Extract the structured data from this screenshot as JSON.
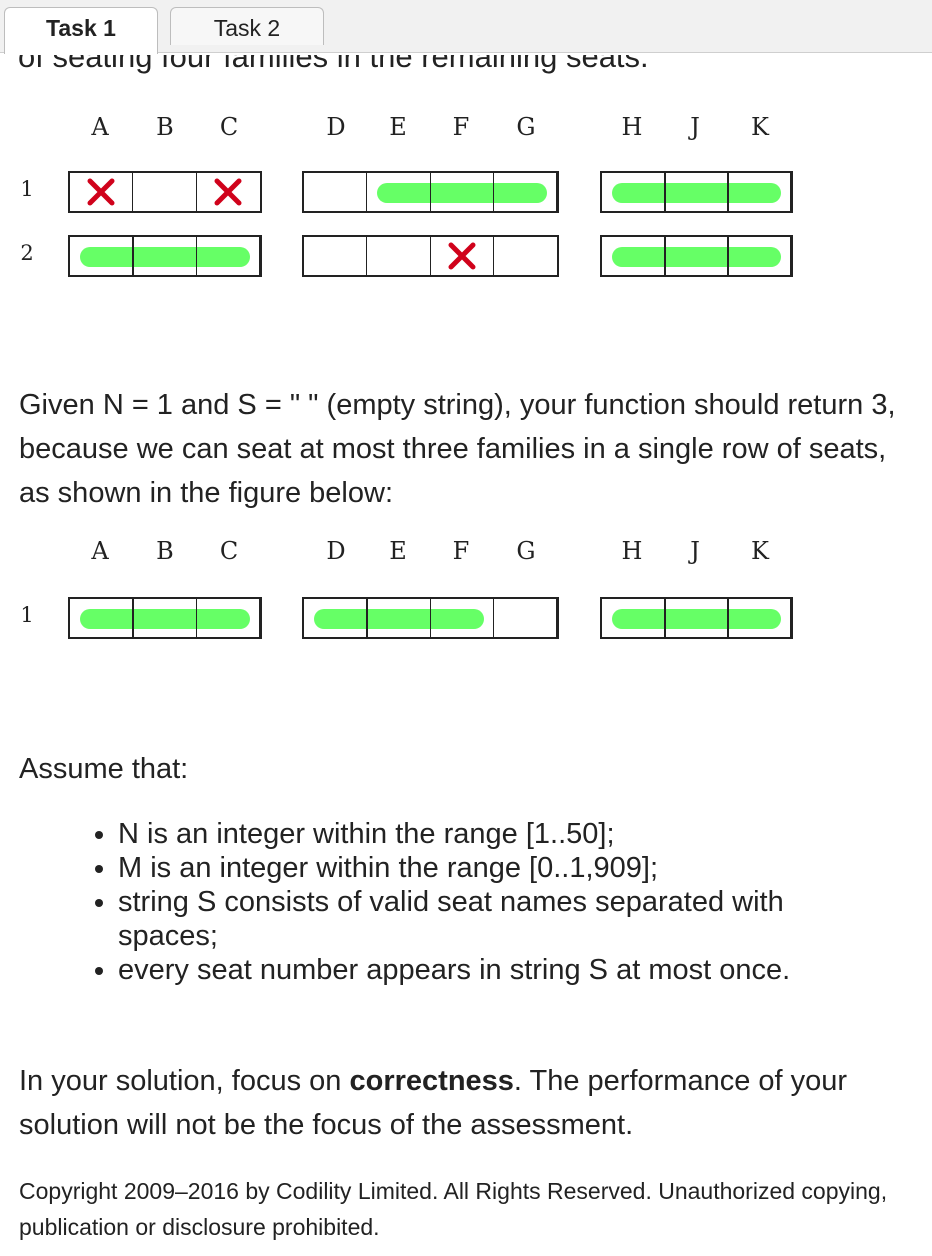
{
  "tabs": [
    {
      "label": "Task 1",
      "active": true
    },
    {
      "label": "Task 2",
      "active": false
    }
  ],
  "cut_text": "of seating four families in the remaining seats.",
  "figure1": {
    "columns": [
      "A",
      "B",
      "C",
      "D",
      "E",
      "F",
      "G",
      "H",
      "J",
      "K"
    ],
    "rows": [
      {
        "label": "1",
        "reserved": [
          "A",
          "C"
        ],
        "families": [
          [
            "E",
            "F",
            "G"
          ],
          [
            "H",
            "J",
            "K"
          ]
        ]
      },
      {
        "label": "2",
        "reserved": [
          "F"
        ],
        "families": [
          [
            "A",
            "B",
            "C"
          ],
          [
            "H",
            "J",
            "K"
          ]
        ]
      }
    ]
  },
  "example_text": "Given N = 1 and S = \" \" (empty string), your function should return 3, because we can seat at most three families in a single row of seats, as shown in the figure below:",
  "figure2": {
    "columns": [
      "A",
      "B",
      "C",
      "D",
      "E",
      "F",
      "G",
      "H",
      "J",
      "K"
    ],
    "rows": [
      {
        "label": "1",
        "reserved": [],
        "families": [
          [
            "A",
            "B",
            "C"
          ],
          [
            "D",
            "E",
            "F"
          ],
          [
            "H",
            "J",
            "K"
          ]
        ]
      }
    ]
  },
  "assume_heading": "Assume that:",
  "assumptions": [
    "N is an integer within the range [1..50];",
    "M is an integer within the range [0..1,909];",
    "string S consists of valid seat names separated with spaces;",
    "every seat number appears in string S at most once."
  ],
  "focus_prefix": "In your solution, focus on ",
  "focus_bold": "correctness",
  "focus_suffix": ". The performance of your solution will not be the focus of the assessment.",
  "copyright": "Copyright 2009–2016 by Codility Limited. All Rights Reserved. Unauthorized copying, publication or disclosure prohibited.",
  "colors": {
    "family_bar": "#66ff66",
    "reserved_x": "#d0021b"
  }
}
